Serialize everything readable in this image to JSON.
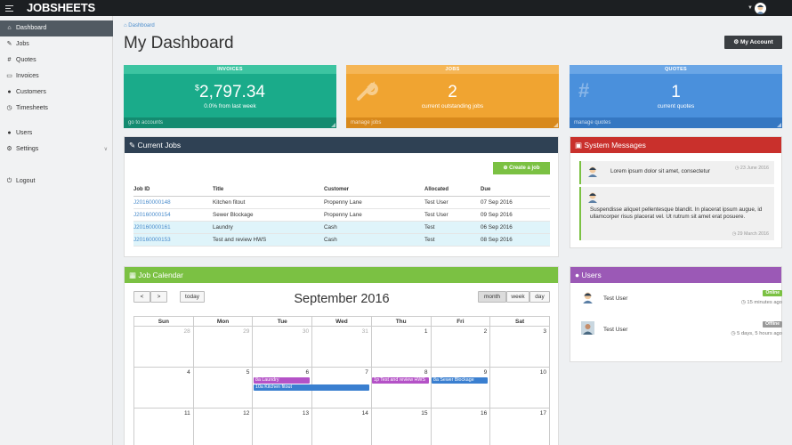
{
  "brand": "JOBSHEETS",
  "sidebar": {
    "items": [
      {
        "label": "Dashboard",
        "icon": "home-icon"
      },
      {
        "label": "Jobs",
        "icon": "wrench-icon"
      },
      {
        "label": "Quotes",
        "icon": "hashtag-icon"
      },
      {
        "label": "Invoices",
        "icon": "money-icon"
      },
      {
        "label": "Customers",
        "icon": "users-icon"
      },
      {
        "label": "Timesheets",
        "icon": "clock-icon"
      },
      {
        "label": "Users",
        "icon": "users-icon"
      },
      {
        "label": "Settings",
        "icon": "cogs-icon"
      },
      {
        "label": "Logout",
        "icon": "power-icon"
      }
    ]
  },
  "breadcrumb": "Dashboard",
  "page_title": "My Dashboard",
  "account_button": "My Account",
  "tiles": {
    "invoices": {
      "header": "INVOICES",
      "currency": "$",
      "value": "2,797.34",
      "sub": "0.0% from last week",
      "footer": "go to accounts",
      "color": "#1aab8a"
    },
    "jobs": {
      "header": "JOBS",
      "value": "2",
      "sub": "current outstanding jobs",
      "footer": "manage jobs",
      "color": "#f0a431"
    },
    "quotes": {
      "header": "QUOTES",
      "value": "1",
      "sub": "current quotes",
      "footer": "manage quotes",
      "color": "#4a90dc"
    }
  },
  "current_jobs": {
    "title": "Current Jobs",
    "create_button": "Create a job",
    "columns": [
      "Job ID",
      "Title",
      "Customer",
      "Allocated",
      "Due"
    ],
    "rows": [
      {
        "id": "J20160000148",
        "title": "Kitchen fitout",
        "customer": "Propenny Lane",
        "allocated": "Test User",
        "due": "07 Sep 2016"
      },
      {
        "id": "J20160000154",
        "title": "Sewer Blockage",
        "customer": "Propenny Lane",
        "allocated": "Test User",
        "due": "09 Sep 2016"
      },
      {
        "id": "J20160000161",
        "title": "Laundry",
        "customer": "Cash",
        "allocated": "Test",
        "due": "06 Sep 2016"
      },
      {
        "id": "J20160000153",
        "title": "Test and review HWS",
        "customer": "Cash",
        "allocated": "Test",
        "due": "08 Sep 2016"
      }
    ]
  },
  "calendar": {
    "title": "Job Calendar",
    "month_title": "September 2016",
    "today_label": "today",
    "prev_label": "<",
    "next_label": ">",
    "views": [
      "month",
      "week",
      "day"
    ],
    "days": [
      "Sun",
      "Mon",
      "Tue",
      "Wed",
      "Thu",
      "Fri",
      "Sat"
    ],
    "weeks": [
      [
        "28",
        "29",
        "30",
        "31",
        "1",
        "2",
        "3"
      ],
      [
        "4",
        "5",
        "6",
        "7",
        "8",
        "9",
        "10"
      ],
      [
        "11",
        "12",
        "13",
        "14",
        "15",
        "16",
        "17"
      ]
    ],
    "events": [
      {
        "label": "8a Laundry",
        "color": "#b452c7"
      },
      {
        "label": "10a Kitchen fitout",
        "color": "#3a7fd0"
      },
      {
        "label": "1p Test and review HWS",
        "color": "#b452c7"
      },
      {
        "label": "8a Sewer Blockage",
        "color": "#3a7fd0"
      }
    ]
  },
  "system_messages": {
    "title": "System Messages",
    "messages": [
      {
        "text": "Lorem ipsum dolor sit amet, consectetur",
        "time": "23 June 2016"
      },
      {
        "text": "Suspendisse aliquet pellentesque blandit. In placerat ipsum augue, id ullamcorper risus placerat vel. Ut rutrum sit amet erat posuere.",
        "time": "29 March 2016"
      }
    ]
  },
  "users": {
    "title": "Users",
    "list": [
      {
        "name": "Test User",
        "status": "Online",
        "seen": "15 minutes ago",
        "status_color": "#7bc143"
      },
      {
        "name": "Test User",
        "status": "Offline",
        "seen": "5 days, 5 hours ago",
        "status_color": "#999999"
      }
    ]
  },
  "colors": {
    "jobs_header": "#2f4154",
    "calendar_header": "#7bc143",
    "messages_header": "#c9302c",
    "users_header": "#9b59b6"
  }
}
